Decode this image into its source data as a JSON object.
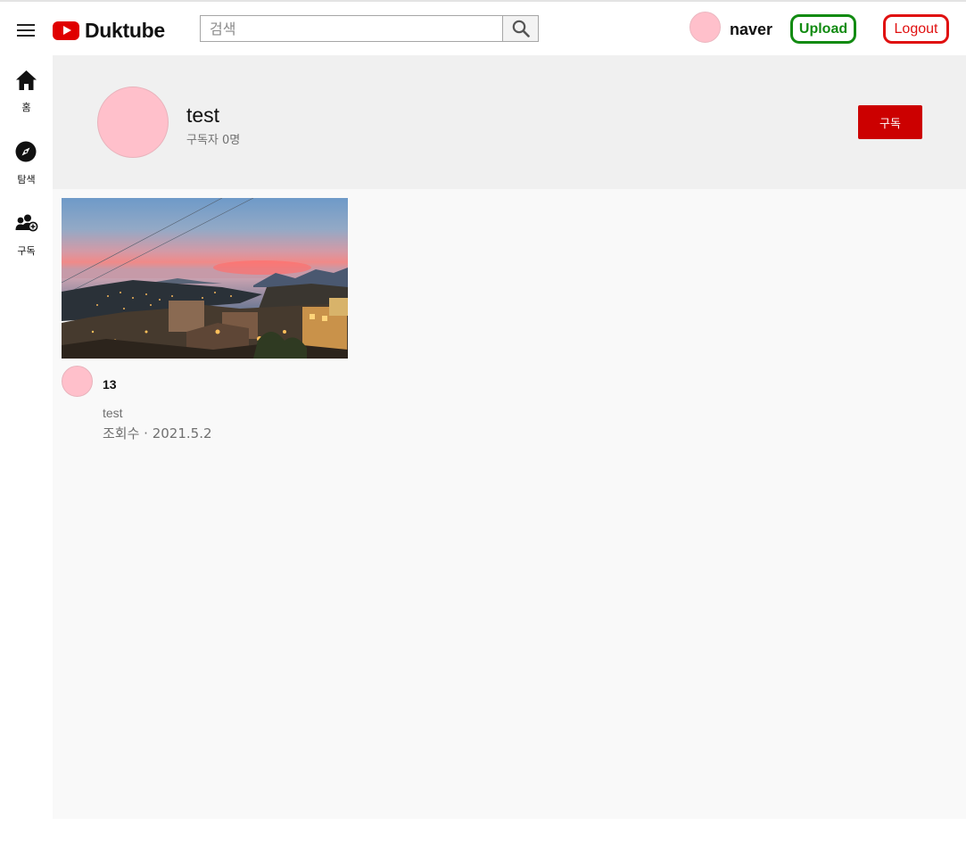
{
  "header": {
    "logo_text": "Duktube",
    "search": {
      "placeholder": "검색",
      "value": ""
    },
    "user_name": "naver",
    "upload_label": "Upload",
    "logout_label": "Logout"
  },
  "sidebar": {
    "items": [
      {
        "label": "홈",
        "icon": "home-icon"
      },
      {
        "label": "탐색",
        "icon": "compass-icon"
      },
      {
        "label": "구독",
        "icon": "subscriptions-icon"
      }
    ]
  },
  "channel": {
    "name": "test",
    "subscribers": "구독자 0명",
    "subscribe_label": "구독"
  },
  "videos": [
    {
      "title": "13",
      "channel": "test",
      "meta": "조회수 · 2021.5.2"
    }
  ],
  "colors": {
    "brand_red": "#e00000",
    "upload_green": "#128b12",
    "logout_red": "#e01010",
    "subscribe_red": "#cc0000",
    "avatar_pink": "#ffc0cb"
  }
}
